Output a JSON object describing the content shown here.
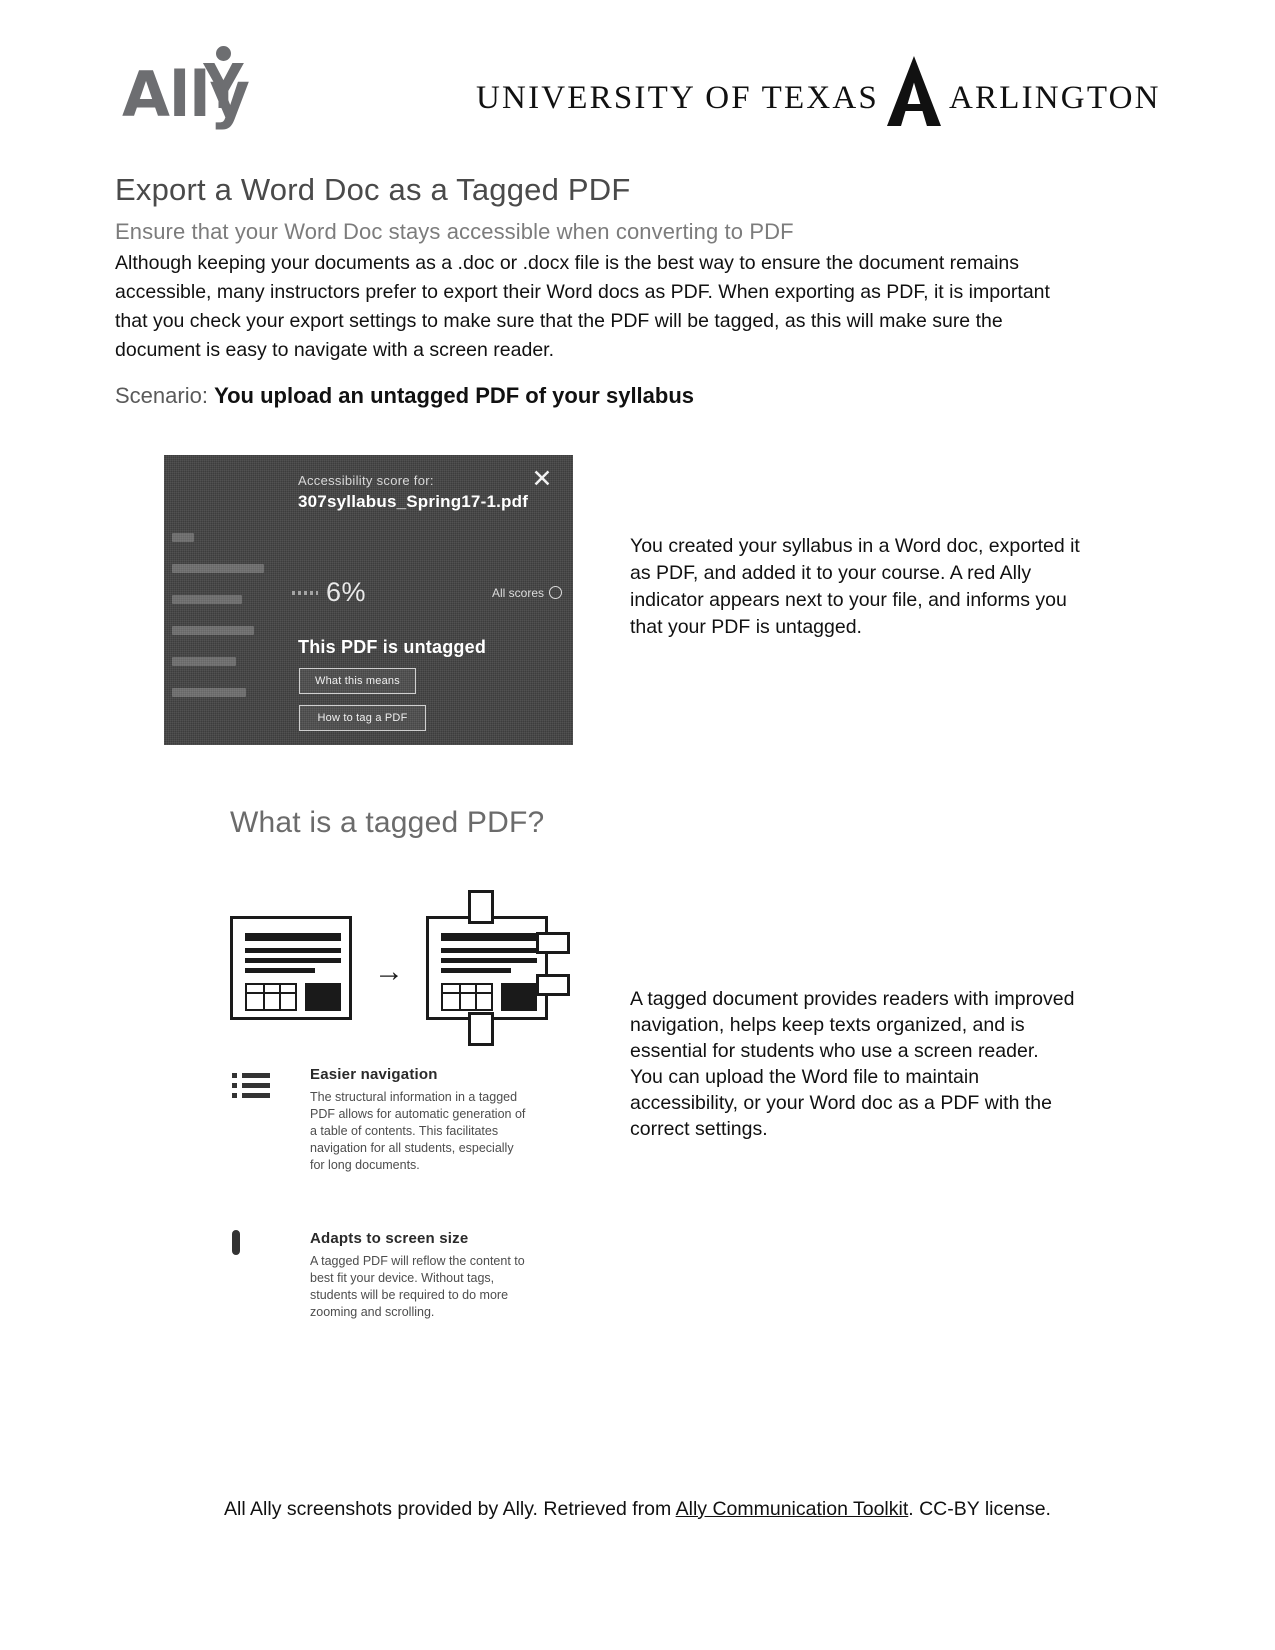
{
  "header": {
    "ally_logo_text": "Ally",
    "ally_logo_icon": "ally-person-icon",
    "university_text_left": "UNIVERSITY OF TEXAS",
    "university_text_right": "ARLINGTON",
    "uta_mark_icon": "uta-a-logo-icon"
  },
  "main": {
    "title": "Export a Word Doc as a Tagged PDF",
    "subtitle": "Ensure that your Word Doc stays accessible when converting to PDF",
    "intro": "Although keeping your documents as a .doc or .docx file is the best way to ensure the document remains accessible, many instructors prefer to export their Word docs as PDF. When exporting as PDF, it is important that you check your export settings to make sure that the PDF will be tagged, as this will make sure the document is easy to navigate with a screen reader.",
    "scenario_label": "Scenario: ",
    "scenario_text": "You upload an untagged PDF of your syllabus",
    "callout_1": "You created your syllabus in a Word doc, exported it as PDF, and added it to your course. A red Ally indicator appears next to your file, and informs you that your PDF is untagged.",
    "section_heading": "What is a tagged PDF?",
    "callout_2": "A tagged document provides readers with improved navigation, helps keep texts organized, and is essential for students who use a screen reader. You can upload the Word file to maintain accessibility, or your Word doc as a PDF with the correct settings."
  },
  "ally_modal": {
    "score_for_label": "Accessibility score for:",
    "filename": "307syllabus_Spring17-1.pdf",
    "score_value": "6%",
    "all_scores_label": "All scores",
    "all_scores_icon": "info-circle-icon",
    "close_icon": "close-x-icon",
    "issue_title": "This PDF is untagged",
    "button_what_this_means": "What this means",
    "button_how_to_tag": "How to tag a PDF"
  },
  "diagram": {
    "left_doc_label": "untagged-document-icon",
    "arrow_icon": "arrow-right-icon",
    "right_doc_label": "tagged-document-icon"
  },
  "features": [
    {
      "icon": "bulleted-list-icon",
      "title": "Easier navigation",
      "text": "The structural information in a tagged PDF allows for automatic generation of a table of contents. This facilitates navigation for all students, especially for long documents."
    },
    {
      "icon": "mobile-phone-icon",
      "title": "Adapts to screen size",
      "text": "A tagged PDF will reflow the content to best fit your device. Without tags, students will be required to do more zooming and scrolling."
    }
  ],
  "footer": {
    "text_before": "All Ally screenshots provided by Ally. Retrieved from ",
    "link_text": "Ally Communication Toolkit",
    "text_after": ". CC-BY license."
  },
  "colors": {
    "heading_gray": "#4a4a4a",
    "subheading_gray": "#7c7c7c",
    "body_black": "#111111",
    "modal_background": "#3d3d3d",
    "ally_logo_gray": "#6d6e71"
  }
}
